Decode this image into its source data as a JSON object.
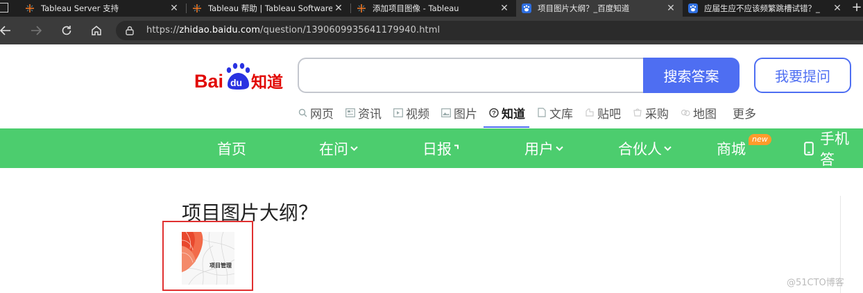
{
  "browser": {
    "tabs": [
      {
        "title": "Tableau Server 支持",
        "close": "✕"
      },
      {
        "title": "Tableau 帮助 | Tableau Software",
        "close": "✕"
      },
      {
        "title": "添加项目图像 - Tableau",
        "close": "✕"
      },
      {
        "title": "项目图片大纲？_百度知道",
        "close": "✕"
      },
      {
        "title": "应届生应不应该频繁跳槽试错？_",
        "close": "✕"
      }
    ],
    "new_tab": "+",
    "url_prefix": "https://",
    "url_host": "zhidao.baidu.com",
    "url_path": "/question/1390609935641179940.html"
  },
  "header": {
    "logo_text_bai": "Bai",
    "logo_text_du": "du",
    "logo_text_zhidao": "知道",
    "search_placeholder": "",
    "search_button": "搜索答案",
    "ask_button": "我要提问"
  },
  "categories": [
    {
      "label": "网页",
      "icon": "search-icon"
    },
    {
      "label": "资讯",
      "icon": "news-icon"
    },
    {
      "label": "视频",
      "icon": "video-icon"
    },
    {
      "label": "图片",
      "icon": "image-icon"
    },
    {
      "label": "知道",
      "icon": "question-icon"
    },
    {
      "label": "文库",
      "icon": "doc-icon"
    },
    {
      "label": "贴吧",
      "icon": "tieba-icon"
    },
    {
      "label": "采购",
      "icon": "cart-icon"
    },
    {
      "label": "地图",
      "icon": "map-icon"
    },
    {
      "label": "更多",
      "icon": ""
    }
  ],
  "green_nav": {
    "items": [
      "首页",
      "在问",
      "日报",
      "用户",
      "合伙人",
      "商城",
      "手机答"
    ],
    "badge": "new"
  },
  "question": {
    "title": "项目图片大纲？",
    "thumbnail_label": "项目管理"
  },
  "watermark": "@51CTO博客",
  "colors": {
    "accent_blue": "#4e6ef2",
    "nav_green": "#4ccd6e",
    "annotation_red": "#e03030",
    "baidu_red": "#e10602",
    "baidu_blue": "#2932e1"
  }
}
